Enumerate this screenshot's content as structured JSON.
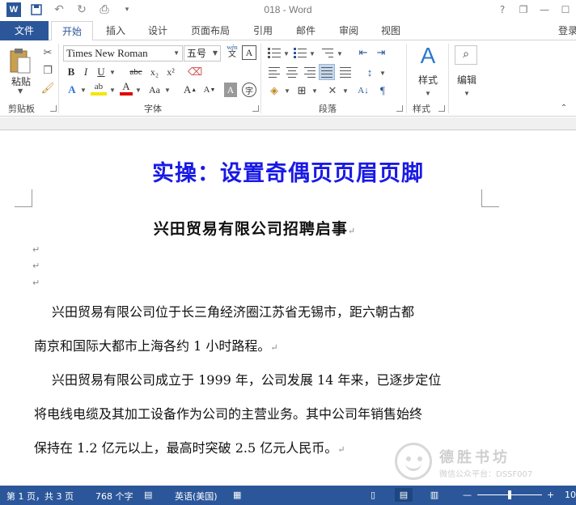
{
  "window": {
    "title": "018 - Word",
    "controls": [
      "?",
      "❐",
      "—",
      "☐"
    ]
  },
  "tabs": {
    "file": "文件",
    "home": "开始",
    "insert": "插入",
    "design": "设计",
    "layout": "页面布局",
    "references": "引用",
    "mailings": "邮件",
    "review": "审阅",
    "view": "视图",
    "signin": "登录"
  },
  "clipboard": {
    "paste": "粘贴",
    "group": "剪贴板"
  },
  "font": {
    "name": "Times New Roman",
    "size": "五号",
    "group": "字体",
    "wen": "wén",
    "wen_char": "文"
  },
  "paragraph": {
    "group": "段落"
  },
  "styles": {
    "label": "样式",
    "group": "样式"
  },
  "editing": {
    "label": "编辑"
  },
  "document": {
    "heading": "实操：设置奇偶页页眉页脚",
    "title": "兴田贸易有限公司招聘启事",
    "para_mark": "↵",
    "lines": [
      "兴田贸易有限公司位于长三角经济圈江苏省无锡市，距六朝古都",
      "南京和国际大都市上海各约 1 小时路程。",
      "兴田贸易有限公司成立于 1999 年，公司发展 14 年来，已逐步定位",
      "将电线电缆及其加工设备作为公司的主营业务。其中公司年销售始终",
      "保持在 1.2 亿元以上，最高时突破 2.5 亿元人民币。"
    ]
  },
  "watermark": {
    "name": "德胜书坊",
    "sub": "微信公众平台：DSSF007"
  },
  "status": {
    "page": "第 1 页，共 3 页",
    "words": "768 个字",
    "lang": "英语(美国)",
    "zoom_minus": "—",
    "zoom_plus": "+",
    "zoom": "10"
  },
  "colors": {
    "accent": "#2b579a",
    "heading": "#1919e6"
  }
}
